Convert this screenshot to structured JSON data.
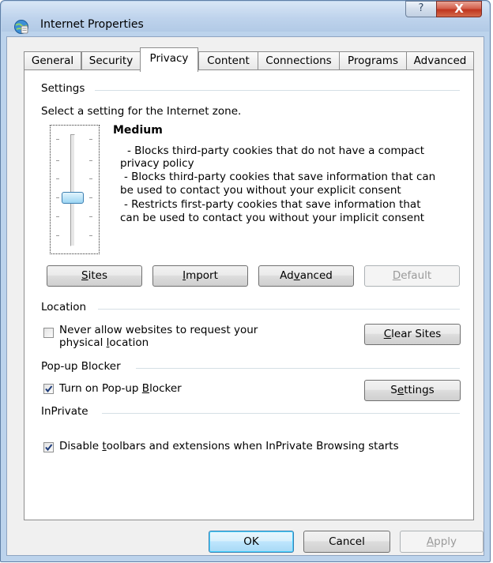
{
  "window": {
    "title": "Internet Properties",
    "help_glyph": "?",
    "close_glyph": "X"
  },
  "tabs": [
    {
      "label": "General"
    },
    {
      "label": "Security"
    },
    {
      "label": "Privacy",
      "active": true
    },
    {
      "label": "Content"
    },
    {
      "label": "Connections"
    },
    {
      "label": "Programs"
    },
    {
      "label": "Advanced"
    }
  ],
  "settings": {
    "group_label": "Settings",
    "prompt": "Select a setting for the Internet zone.",
    "level_title": "Medium",
    "description_lines": [
      "- Blocks third-party cookies that do not have a compact",
      "privacy policy",
      "- Blocks third-party cookies that save information that can",
      "be used to contact you without your explicit consent",
      "- Restricts first-party cookies that save information that",
      "can be used to contact you without your implicit consent"
    ],
    "slider_level": "Medium",
    "buttons": {
      "sites": {
        "label_key": "S",
        "label_rest": "ites"
      },
      "import": {
        "label_key": "I",
        "label_rest": "mport"
      },
      "advanced": {
        "label_pre": "Ad",
        "label_key": "v",
        "label_rest": "anced"
      },
      "default": {
        "label_key": "D",
        "label_rest": "efault"
      }
    }
  },
  "location": {
    "group_label": "Location",
    "checkbox_checked": false,
    "checkbox_line1": "Never allow websites to request your",
    "checkbox_line2_pre": "physical ",
    "checkbox_line2_key": "l",
    "checkbox_line2_rest": "ocation",
    "clear_sites": {
      "label_key": "C",
      "label_rest": "lear Sites"
    }
  },
  "popup": {
    "group_label": "Pop-up Blocker",
    "checkbox_checked": true,
    "checkbox_pre": "Turn on Pop-up ",
    "checkbox_key": "B",
    "checkbox_rest": "locker",
    "settings_button": {
      "label_pre": "S",
      "label_key": "e",
      "label_rest": "ttings"
    }
  },
  "inprivate": {
    "group_label": "InPrivate",
    "checkbox_checked": true,
    "checkbox_pre": "Disable ",
    "checkbox_key": "t",
    "checkbox_rest": "oolbars and extensions when InPrivate Browsing starts"
  },
  "footer": {
    "ok": "OK",
    "cancel": "Cancel",
    "apply_key": "A",
    "apply_rest": "pply"
  },
  "colors": {
    "frame": "#bcd3ec",
    "close_button": "#c0351f",
    "slider_thumb": "#9cd5f3"
  }
}
